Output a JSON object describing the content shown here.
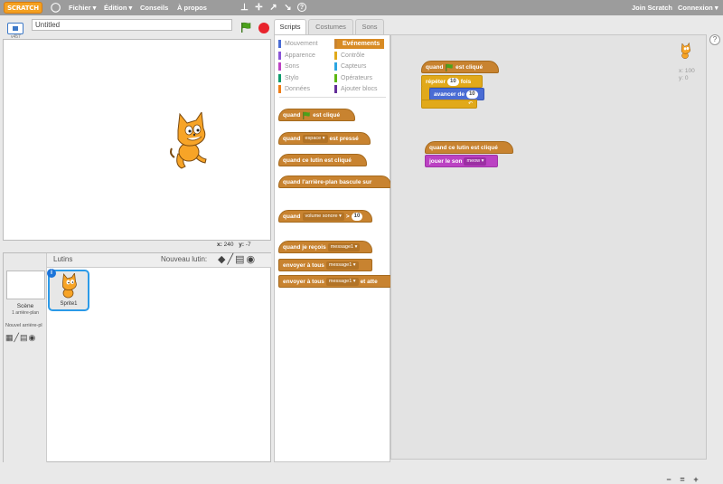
{
  "topbar": {
    "logo": "SCRATCH",
    "menu": [
      "Fichier ▾",
      "Édition ▾",
      "Conseils",
      "À propos"
    ],
    "join": "Join Scratch",
    "connexion": "Connexion ▾"
  },
  "stage": {
    "title_value": "Untitled",
    "version": "v457",
    "coords_x_label": "x:",
    "coords_x": "240",
    "coords_y_label": "y:",
    "coords_y": "-7"
  },
  "sprites": {
    "header_label": "Lutins",
    "new_sprite_label": "Nouveau lutin:",
    "scene_label": "Scène",
    "scene_sub": "1 arrière-plan",
    "new_backdrop_label": "Nouvel arrière-pl",
    "sprite1_name": "Sprite1"
  },
  "tabs": [
    "Scripts",
    "Costumes",
    "Sons"
  ],
  "categories": {
    "left": [
      {
        "label": "Mouvement",
        "color": "#4a6cd4"
      },
      {
        "label": "Apparence",
        "color": "#8a55d7"
      },
      {
        "label": "Sons",
        "color": "#bb42c3"
      },
      {
        "label": "Stylo",
        "color": "#0e9a6c"
      },
      {
        "label": "Données",
        "color": "#ee7d16"
      }
    ],
    "right": [
      {
        "label": "Evénements",
        "color": "#c88330"
      },
      {
        "label": "Contrôle",
        "color": "#e1a91a"
      },
      {
        "label": "Capteurs",
        "color": "#2ca5e2"
      },
      {
        "label": "Opérateurs",
        "color": "#5cb712"
      },
      {
        "label": "Ajouter blocs",
        "color": "#632d99"
      }
    ]
  },
  "palette_blocks": {
    "when_flag_a": "quand",
    "when_flag_b": "est cliqué",
    "when_key_a": "quand",
    "when_key_drop": "espace ▾",
    "when_key_b": "est pressé",
    "when_sprite": "quand ce lutin est cliqué",
    "when_backdrop": "quand l'arrière-plan bascule sur",
    "when_volume_a": "quand",
    "when_volume_drop": "volume sonore ▾",
    "when_volume_op": ">",
    "when_volume_val": "10",
    "when_receive_a": "quand je reçois",
    "when_receive_drop": "message1 ▾",
    "broadcast_a": "envoyer à tous",
    "broadcast_drop": "message1 ▾",
    "broadcast_wait_a": "envoyer à tous",
    "broadcast_wait_drop": "message1 ▾",
    "broadcast_wait_b": "et atte"
  },
  "script_blocks": {
    "s1_hat_a": "quand",
    "s1_hat_b": "est cliqué",
    "s1_repeat_a": "répéter",
    "s1_repeat_val": "10",
    "s1_repeat_b": "fois",
    "s1_move_a": "avancer de",
    "s1_move_val": "10",
    "s2_hat": "quand ce lutin est cliqué",
    "s2_play_a": "jouer le son",
    "s2_play_drop": "meow ▾"
  },
  "sprite_info": {
    "x_label": "x: 100",
    "y_label": "y: 0"
  },
  "zoom": [
    "−",
    "=",
    "+"
  ],
  "colors": {
    "events": "#c88330",
    "motion": "#4a6cd4",
    "control": "#e1a91a",
    "sound": "#bb42c3",
    "topbar": "#9c9c9c"
  }
}
